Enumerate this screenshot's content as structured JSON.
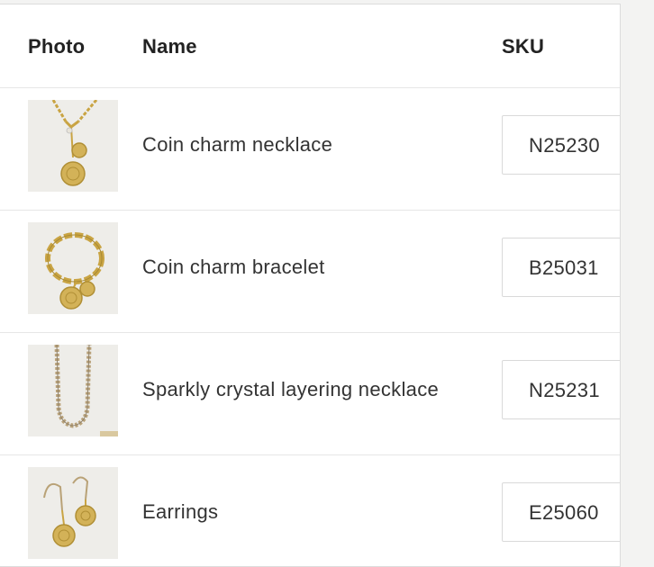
{
  "table": {
    "headers": {
      "photo": "Photo",
      "name": "Name",
      "sku": "SKU"
    },
    "rows": [
      {
        "photo_icon": "necklace-photo",
        "name": "Coin charm necklace",
        "sku": "N25230"
      },
      {
        "photo_icon": "bracelet-photo",
        "name": "Coin charm bracelet",
        "sku": "B25031"
      },
      {
        "photo_icon": "crystal-necklace-photo",
        "name": "Sparkly crystal layering necklace",
        "sku": "N25231"
      },
      {
        "photo_icon": "earrings-photo",
        "name": "Earrings",
        "sku": "E25060"
      }
    ]
  },
  "colors": {
    "background": "#f3f3f2",
    "panel": "#ffffff",
    "border": "#e6e6e6",
    "text": "#333333",
    "gold": "#c9a443"
  }
}
